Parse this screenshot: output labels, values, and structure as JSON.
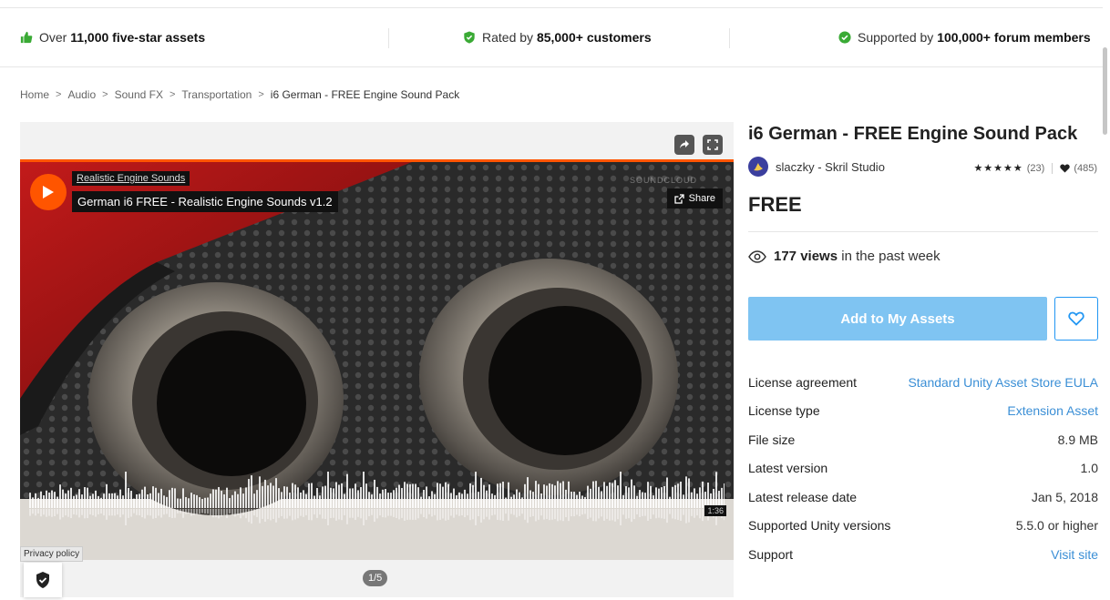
{
  "trust_bar": {
    "item1": {
      "prefix": "Over",
      "bold": "11,000 five-star assets"
    },
    "item2": {
      "prefix": "Rated by",
      "bold": "85,000+ customers"
    },
    "item3": {
      "prefix": "Supported by",
      "bold": "100,000+ forum members"
    },
    "icons": [
      "thumbs-up-icon",
      "shield-check-icon",
      "check-circle-icon"
    ],
    "accent_color": "#3aaa35"
  },
  "breadcrumb": {
    "items": [
      "Home",
      "Audio",
      "Sound FX",
      "Transportation"
    ],
    "current": "i6 German - FREE Engine Sound Pack"
  },
  "viewer": {
    "track_artist": "Realistic Engine Sounds",
    "track_title": "German i6 FREE - Realistic Engine Sounds v1.2",
    "share_label": "Share",
    "soundcloud_mark": "SOUNDCLOUD",
    "duration": "1:36",
    "privacy_label": "Privacy policy",
    "pager": "1/5",
    "player_accent": "#ff5500"
  },
  "product": {
    "title": "i6 German - FREE Engine Sound Pack",
    "publisher": "slaczky - Skril Studio",
    "stars": "★★★★★",
    "rating_count": "(23)",
    "favorites": "(485)",
    "price": "FREE",
    "views_bold": "177 views",
    "views_rest": "in the past week",
    "add_button": "Add to My Assets",
    "add_button_color": "#7fc4f2",
    "link_color": "#3b8fd6"
  },
  "details": [
    {
      "label": "License agreement",
      "value": "Standard Unity Asset Store EULA",
      "link": true
    },
    {
      "label": "License type",
      "value": "Extension Asset",
      "link": true
    },
    {
      "label": "File size",
      "value": "8.9 MB",
      "link": false
    },
    {
      "label": "Latest version",
      "value": "1.0",
      "link": false
    },
    {
      "label": "Latest release date",
      "value": "Jan 5, 2018",
      "link": false
    },
    {
      "label": "Supported Unity versions",
      "value": "5.5.0 or higher",
      "link": false
    },
    {
      "label": "Support",
      "value": "Visit site",
      "link": true
    }
  ]
}
